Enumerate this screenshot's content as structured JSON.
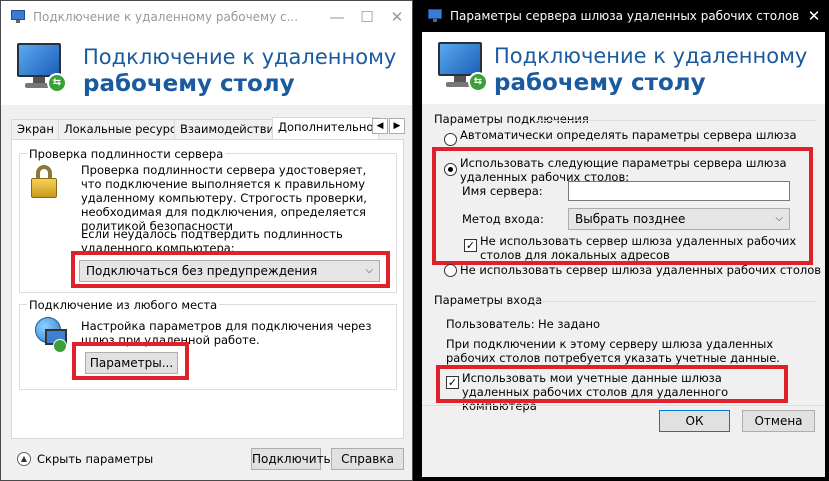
{
  "left_window": {
    "title": "Подключение к удаленному рабочему с...",
    "min_icon": "minimize-icon",
    "max_icon": "maximize-icon",
    "close_glyph": "✕",
    "header_line1": "Подключение к удаленному",
    "header_line2": "рабочему столу",
    "tabs": [
      "Экран",
      "Локальные ресурсы",
      "Взаимодействие",
      "Дополнительно"
    ],
    "auth_group": {
      "title": "Проверка подлинности сервера",
      "description": "Проверка подлинности сервера удостоверяет, что подключение выполняется к правильному удаленному компьютеру. Строгость проверки, необходимая для подключения, определяется политикой безопасности",
      "fail_label": "Если неудалось подтвердить подлинность удаленного компьютера:",
      "selected": "Подключаться без предупреждения"
    },
    "anywhere_group": {
      "title": "Подключение из любого места",
      "description": "Настройка параметров для подключения через шлюз при удаленной работе.",
      "settings_button": "Параметры..."
    },
    "footer": {
      "hide_options": "Скрыть параметры",
      "connect": "Подключить",
      "help": "Справка"
    }
  },
  "right_window": {
    "title": "Параметры сервера шлюза удаленных рабочих столов",
    "close_glyph": "✕",
    "header_line1": "Подключение к удаленному",
    "header_line2": "рабочему столу",
    "connection_group": {
      "title": "Параметры подключения",
      "auto_detect": "Автоматически определять параметры сервера шлюза удаленных рабочих столов",
      "use_settings": "Использовать следующие параметры сервера шлюза удаленных рабочих столов:",
      "server_name_label": "Имя сервера:",
      "server_name_value": "",
      "logon_method_label": "Метод входа:",
      "logon_method_value": "Выбрать позднее",
      "bypass_local": "Не использовать сервер шлюза удаленных рабочих столов для локальных адресов",
      "no_gateway": "Не использовать сервер шлюза удаленных рабочих столов"
    },
    "logon_group": {
      "title": "Параметры входа",
      "user_label": "Пользователь:",
      "user_value": "Не задано",
      "info": "При подключении к этому серверу шлюза удаленных рабочих столов потребуется указать учетные данные.",
      "use_credentials": "Использовать мои учетные данные шлюза удаленных рабочих столов для удаленного компьютера"
    },
    "ok": "ОК",
    "cancel": "Отмена"
  },
  "check_glyph": "✓",
  "chevron_glyph": "⌵",
  "highlight_color": "#e0202a",
  "accent_color": "#1a5a9f"
}
